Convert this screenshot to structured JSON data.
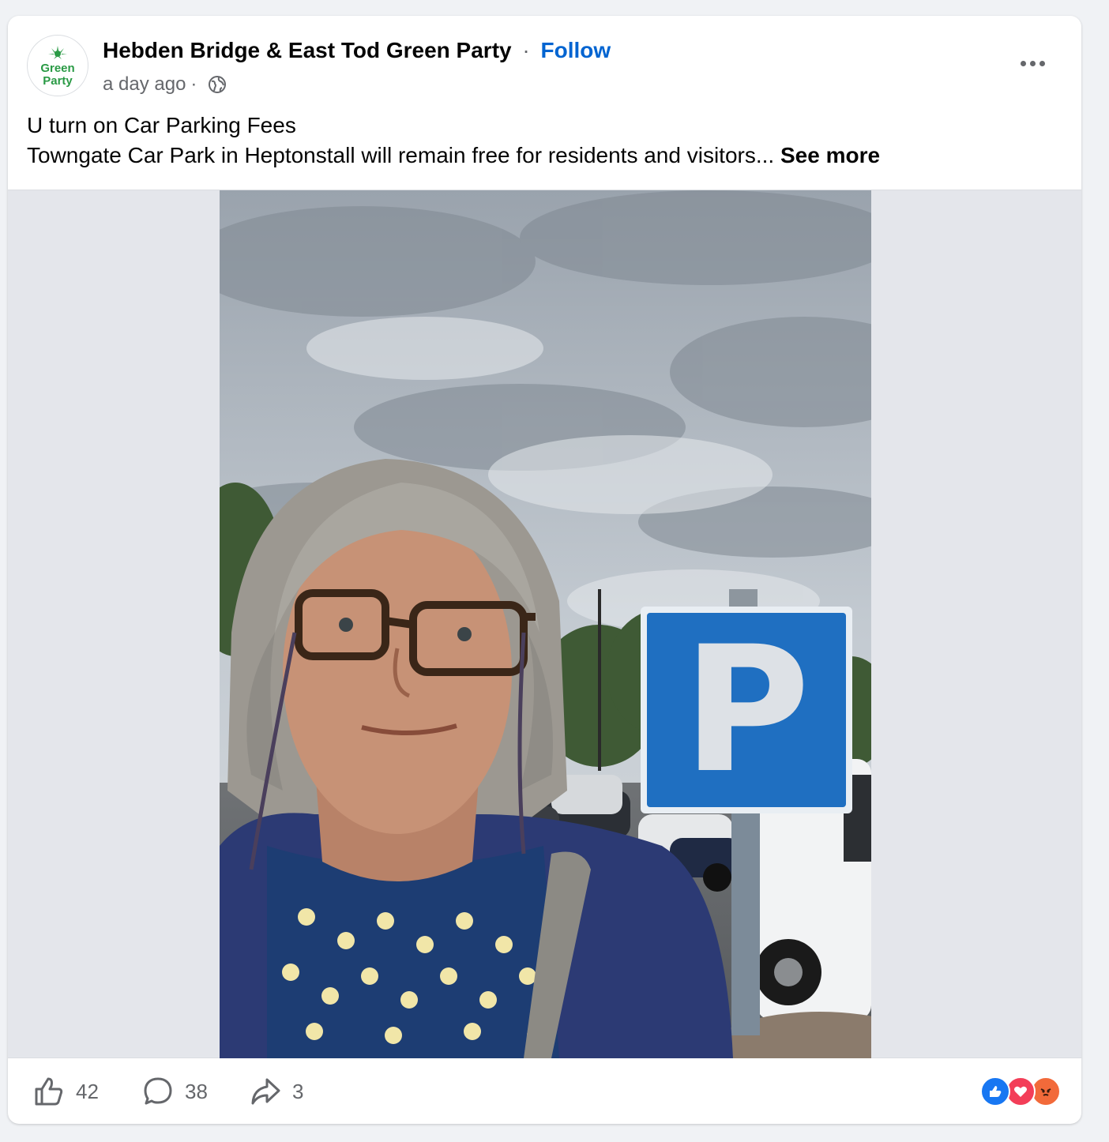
{
  "post": {
    "page_name": "Hebden Bridge & East Tod Green Party",
    "separator": "·",
    "follow_label": "Follow",
    "timestamp": "a day ago",
    "audience_icon": "globe-icon",
    "avatar_text_line1": "Green",
    "avatar_text_line2": "Party",
    "text_line1": "U turn on Car Parking Fees",
    "text_line2": "Towngate Car Park in Heptonstall will remain free for residents and visitors...",
    "see_more_label": "See more"
  },
  "photo": {
    "sign_letter": "P"
  },
  "footer": {
    "like_count": "42",
    "comment_count": "38",
    "share_count": "3",
    "reactions": [
      "like-reaction-icon",
      "love-reaction-icon",
      "angry-reaction-icon"
    ]
  },
  "colors": {
    "brand_green": "#2a9a45",
    "link_blue": "#0064d1",
    "sign_blue": "#1f6fc1",
    "muted_text": "#65676b"
  }
}
